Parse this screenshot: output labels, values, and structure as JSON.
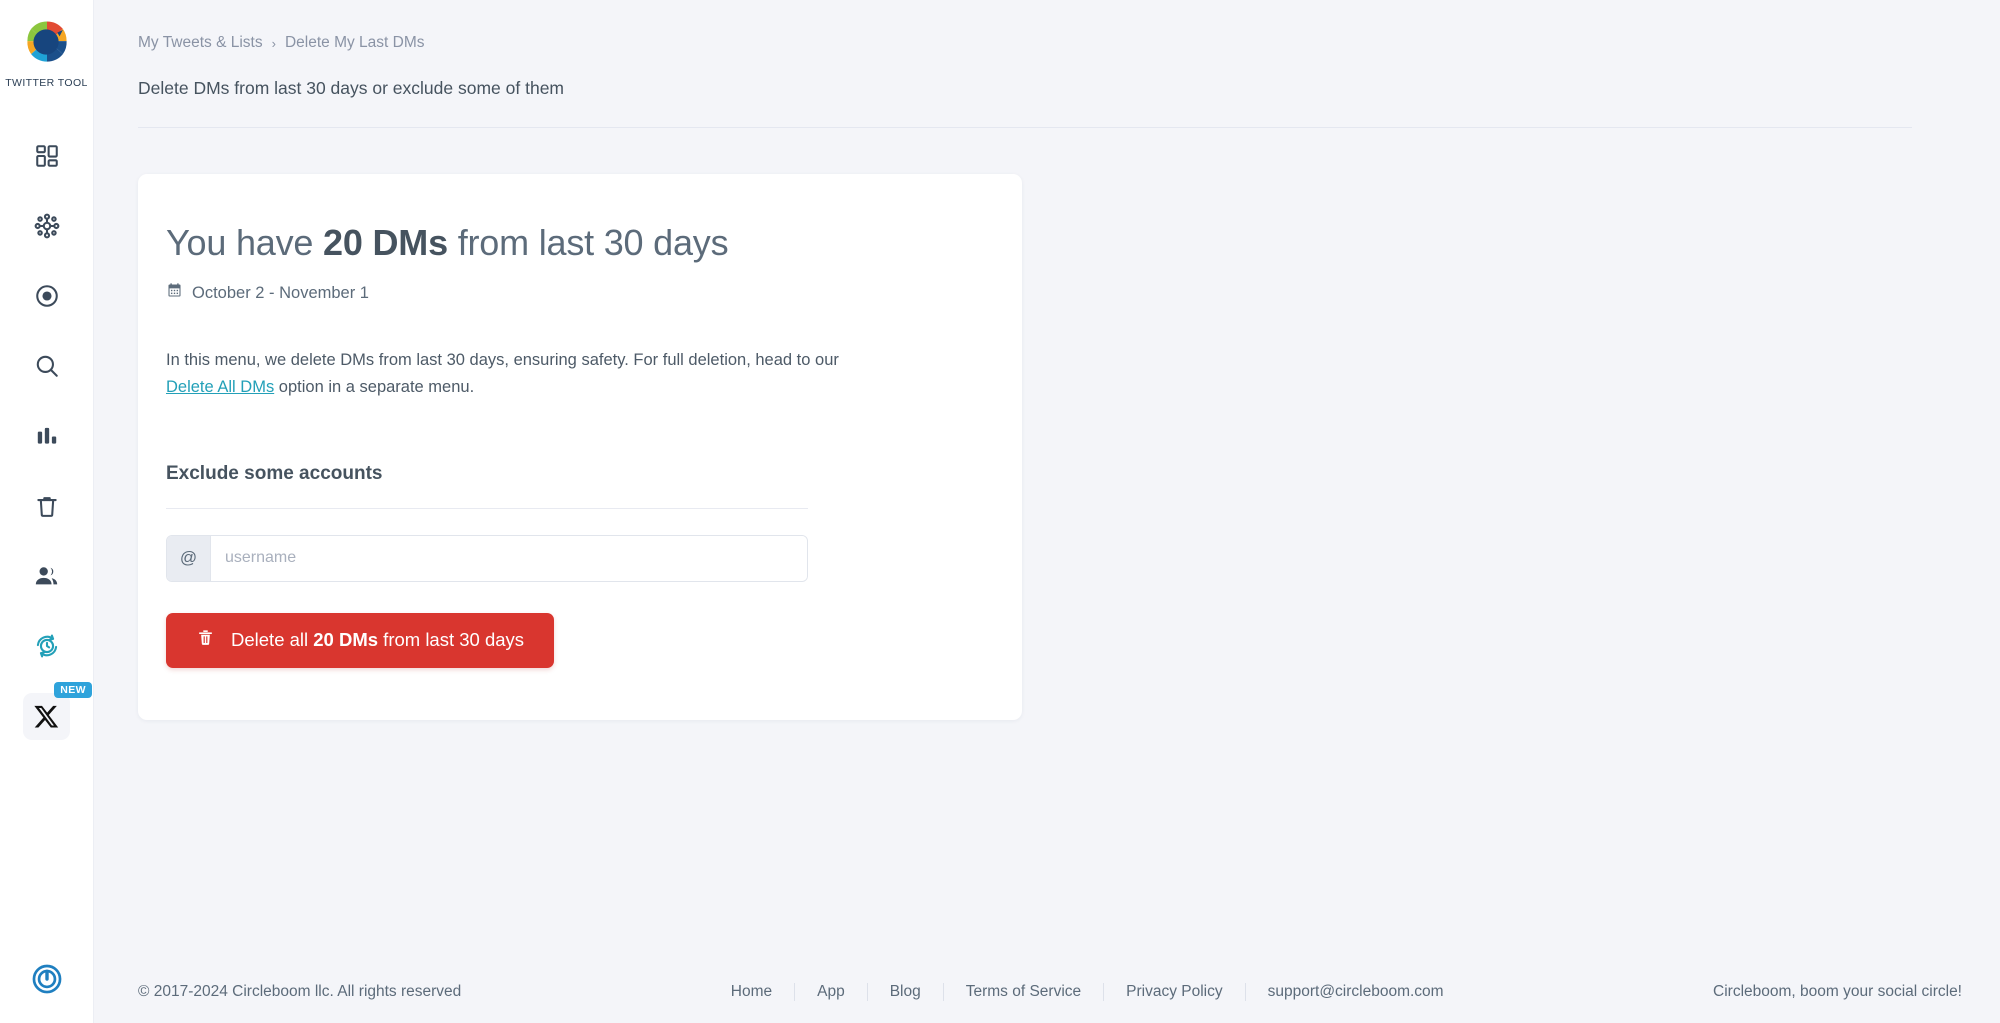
{
  "brand": {
    "name": "TWITTER TOOL",
    "logo_icon": "circleboom-logo-icon"
  },
  "sidebar": {
    "items": [
      {
        "icon": "dashboard-grid-icon",
        "name": "sidebar-item-dashboard"
      },
      {
        "icon": "network-hub-icon",
        "name": "sidebar-item-network"
      },
      {
        "icon": "target-circle-icon",
        "name": "sidebar-item-target"
      },
      {
        "icon": "search-icon",
        "name": "sidebar-item-search"
      },
      {
        "icon": "bar-chart-icon",
        "name": "sidebar-item-analytics"
      },
      {
        "icon": "trash-icon",
        "name": "sidebar-item-delete"
      },
      {
        "icon": "people-icon",
        "name": "sidebar-item-accounts"
      },
      {
        "icon": "history-clock-icon",
        "name": "sidebar-item-scheduled"
      }
    ],
    "x_item": {
      "icon": "x-logo-icon",
      "badge": "NEW"
    },
    "logout": {
      "icon": "power-logout-icon"
    }
  },
  "breadcrumb": {
    "parent": "My Tweets & Lists",
    "separator": "›",
    "current": "Delete My Last DMs"
  },
  "header": {
    "subtitle": "Delete DMs from last 30 days or exclude some of them"
  },
  "card": {
    "title_prefix": "You have ",
    "title_count": "20 DMs",
    "title_suffix": " from last 30 days",
    "date_icon": "calendar-icon",
    "date_range": "October 2 - November 1",
    "description_before": "In this menu, we delete DMs from last 30 days, ensuring safety. For full deletion, head to our ",
    "description_link": "Delete All DMs",
    "description_after": " option in a separate menu.",
    "exclude_title": "Exclude some accounts",
    "input_prefix": "@",
    "input_placeholder": "username",
    "input_value": "",
    "delete_icon": "trash-icon",
    "delete_before": "Delete all ",
    "delete_count": "20 DMs",
    "delete_after": " from last 30 days"
  },
  "footer": {
    "copyright": "© 2017-2024 Circleboom llc. All rights reserved",
    "links": [
      "Home",
      "App",
      "Blog",
      "Terms of Service",
      "Privacy Policy",
      "support@circleboom.com"
    ],
    "tagline": "Circleboom, boom your social circle!"
  },
  "colors": {
    "accent_teal": "#23a0b8",
    "danger_red": "#d9362f",
    "badge_blue": "#2fa3db",
    "page_bg": "#f4f5f9"
  }
}
